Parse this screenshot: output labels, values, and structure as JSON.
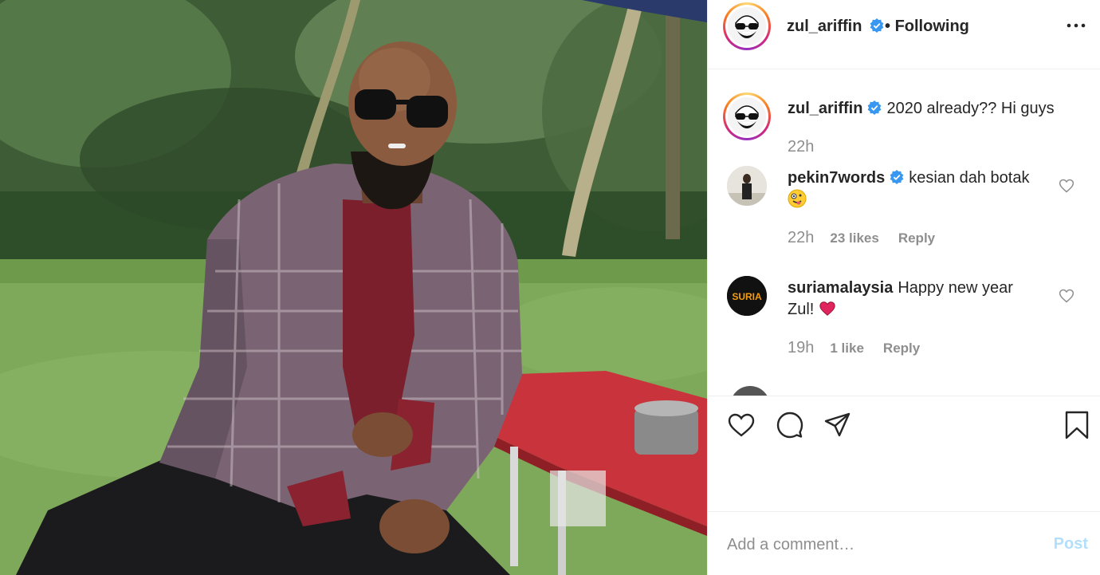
{
  "post": {
    "author": "zul_ariffin",
    "follow_status": "Following",
    "caption_text": "2020 already?? Hi guys",
    "caption_time": "22h"
  },
  "comments": [
    {
      "user": "pekin7words",
      "verified": true,
      "text": "kesian dah botak",
      "emoji": "crazy-face-emoji",
      "time": "22h",
      "likes": "23 likes",
      "reply": "Reply"
    },
    {
      "user": "suriamalaysia",
      "verified": false,
      "text_line1": "Happy new year",
      "text_line2": "Zul!",
      "emoji": "red-heart-emoji",
      "time": "19h",
      "likes": "1 like",
      "reply": "Reply"
    }
  ],
  "avatar_labels": {
    "suria": "SURIA"
  },
  "add_comment": {
    "placeholder": "Add a comment…",
    "post_label": "Post"
  },
  "icons": [
    "more-options-icon",
    "verified-badge-icon",
    "heart-icon",
    "comment-icon",
    "share-icon",
    "bookmark-icon"
  ],
  "colors": {
    "verified_blue": "#3897f0",
    "post_button": "#b2dffc",
    "meta_gray": "#8e8e8e",
    "heart_red": "#e0245e"
  }
}
